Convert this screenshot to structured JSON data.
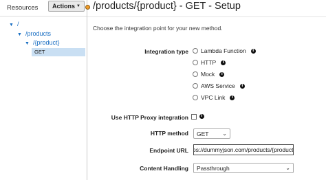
{
  "sidebar": {
    "tab_label": "Resources",
    "actions_label": "Actions",
    "tree": [
      {
        "label": "/"
      },
      {
        "label": "/products"
      },
      {
        "label": "/{product}"
      },
      {
        "label": "GET"
      }
    ]
  },
  "main": {
    "title": "/products/{product} - GET - Setup",
    "subtitle": "Choose the integration point for your new method.",
    "integration_type": {
      "label": "Integration type",
      "options": [
        {
          "label": "Lambda Function",
          "selected": false
        },
        {
          "label": "HTTP",
          "selected": false
        },
        {
          "label": "Mock",
          "selected": false
        },
        {
          "label": "AWS Service",
          "selected": false
        },
        {
          "label": "VPC Link",
          "selected": false
        }
      ]
    },
    "proxy": {
      "label": "Use HTTP Proxy integration",
      "checked": false
    },
    "http_method": {
      "label": "HTTP method",
      "value": "GET"
    },
    "endpoint_url": {
      "label": "Endpoint URL",
      "value": "ps://dummyjson.com/products/{product}"
    },
    "content_handling": {
      "label": "Content Handling",
      "value": "Passthrough"
    }
  },
  "colors": {
    "link": "#1a6fc3",
    "selected_row": "#c9dff3",
    "resizer": "#f09c2a"
  }
}
